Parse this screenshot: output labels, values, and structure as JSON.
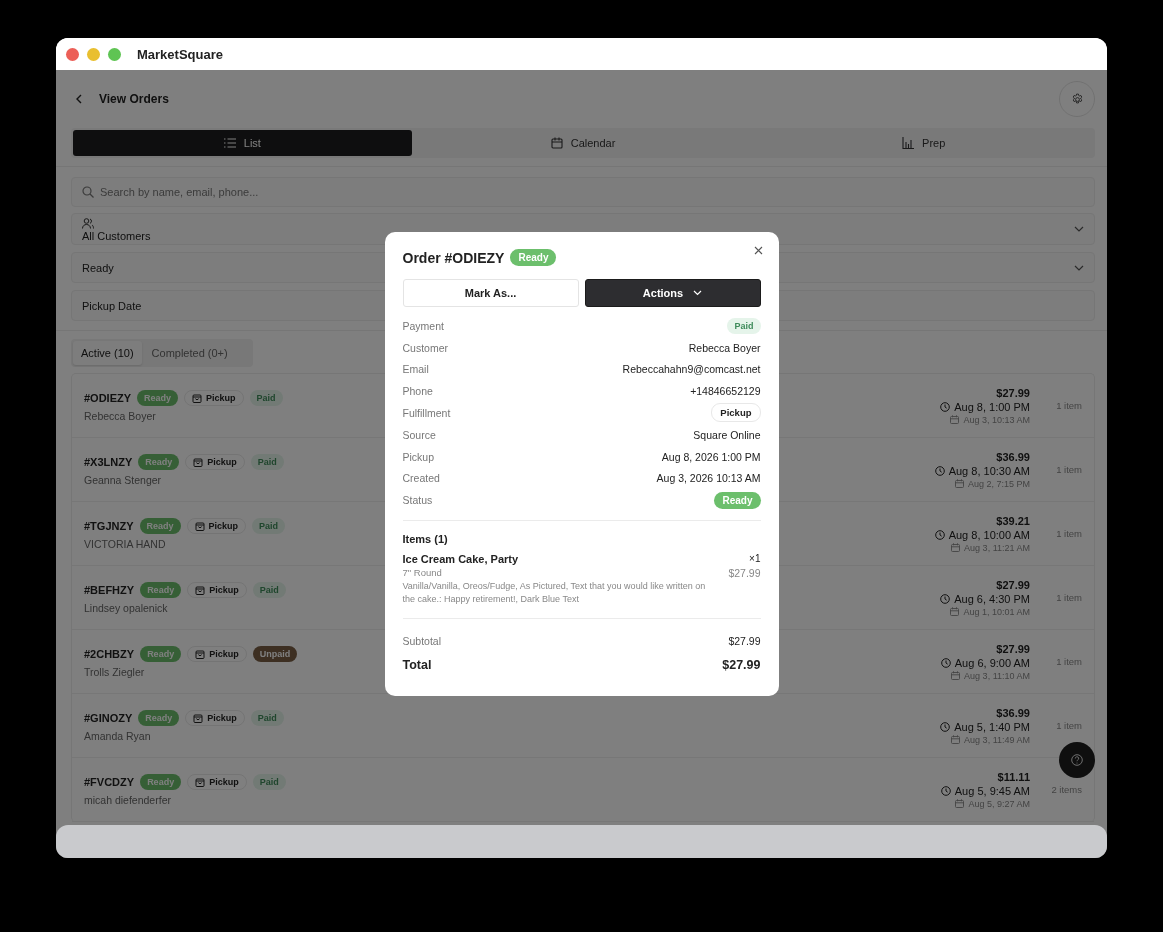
{
  "window": {
    "title": "MarketSquare"
  },
  "page": {
    "title": "View Orders"
  },
  "view_tabs": [
    {
      "label": "List",
      "selected": true
    },
    {
      "label": "Calendar",
      "selected": false
    },
    {
      "label": "Prep",
      "selected": false
    }
  ],
  "search": {
    "placeholder": "Search by name, email, phone..."
  },
  "filters": [
    {
      "label": "All Customers",
      "kind": "customers"
    },
    {
      "label": "Ready",
      "kind": "dropdown"
    },
    {
      "label": "Pickup Date",
      "kind": "date"
    }
  ],
  "status_tabs": [
    {
      "label": "Active (10)",
      "selected": true
    },
    {
      "label": "Completed (0+)",
      "selected": false
    }
  ],
  "orders": [
    {
      "id": "#ODIEZY",
      "status": "Ready",
      "fulfillment": "Pickup",
      "payment": {
        "label": "Paid",
        "kind": "paid"
      },
      "customer": "Rebecca Boyer",
      "total": "$27.99",
      "pickup": "Aug 8, 1:00 PM",
      "created": "Aug 3, 10:13 AM",
      "items": "1 item"
    },
    {
      "id": "#X3LNZY",
      "status": "Ready",
      "fulfillment": "Pickup",
      "payment": {
        "label": "Paid",
        "kind": "paid"
      },
      "customer": "Geanna Stenger",
      "total": "$36.99",
      "pickup": "Aug 8, 10:30 AM",
      "created": "Aug 2, 7:15 PM",
      "items": "1 item"
    },
    {
      "id": "#TGJNZY",
      "status": "Ready",
      "fulfillment": "Pickup",
      "payment": {
        "label": "Paid",
        "kind": "paid"
      },
      "customer": "VICTORIA HAND",
      "total": "$39.21",
      "pickup": "Aug 8, 10:00 AM",
      "created": "Aug 3, 11:21 AM",
      "items": "1 item"
    },
    {
      "id": "#BEFHZY",
      "status": "Ready",
      "fulfillment": "Pickup",
      "payment": {
        "label": "Paid",
        "kind": "paid"
      },
      "customer": "Lindsey opalenick",
      "total": "$27.99",
      "pickup": "Aug 6, 4:30 PM",
      "created": "Aug 1, 10:01 AM",
      "items": "1 item"
    },
    {
      "id": "#2CHBZY",
      "status": "Ready",
      "fulfillment": "Pickup",
      "payment": {
        "label": "Unpaid",
        "kind": "unpaid"
      },
      "customer": "Trolls Ziegler",
      "total": "$27.99",
      "pickup": "Aug 6, 9:00 AM",
      "created": "Aug 3, 11:10 AM",
      "items": "1 item"
    },
    {
      "id": "#GINOZY",
      "status": "Ready",
      "fulfillment": "Pickup",
      "payment": {
        "label": "Paid",
        "kind": "paid"
      },
      "customer": "Amanda Ryan",
      "total": "$36.99",
      "pickup": "Aug 5, 1:40 PM",
      "created": "Aug 3, 11:49 AM",
      "items": "1 item"
    },
    {
      "id": "#FVCDZY",
      "status": "Ready",
      "fulfillment": "Pickup",
      "payment": {
        "label": "Paid",
        "kind": "paid"
      },
      "customer": "micah diefenderfer",
      "total": "$11.11",
      "pickup": "Aug 5, 9:45 AM",
      "created": "Aug 5, 9:27 AM",
      "items": "2 items"
    }
  ],
  "modal": {
    "title": "Order #ODIEZY",
    "status": "Ready",
    "buttons": [
      {
        "label": "Mark As...",
        "kind": "outline"
      },
      {
        "label": "Actions",
        "kind": "dropdown"
      }
    ],
    "details": [
      {
        "label": "Payment",
        "value": "Paid",
        "kind": "paid"
      },
      {
        "label": "Customer",
        "value": "Rebecca Boyer",
        "kind": "text"
      },
      {
        "label": "Email",
        "value": "Rebeccahahn9@comcast.net",
        "kind": "text"
      },
      {
        "label": "Phone",
        "value": "+14846652129",
        "kind": "text"
      },
      {
        "label": "Fulfillment",
        "value": "Pickup",
        "kind": "pill"
      },
      {
        "label": "Source",
        "value": "Square Online",
        "kind": "text"
      },
      {
        "label": "Pickup",
        "value": "Aug 8, 2026 1:00 PM",
        "kind": "text"
      },
      {
        "label": "Created",
        "value": "Aug 3, 2026 10:13 AM",
        "kind": "text"
      },
      {
        "label": "Status",
        "value": "Ready",
        "kind": "ready"
      }
    ],
    "items_heading": "Items (1)",
    "items": [
      {
        "name": "Ice Cream Cake, Party",
        "variant": "7\" Round",
        "options": "Vanilla/Vanilla, Oreos/Fudge, As Pictured, Text that you would like written on the cake.: Happy retirement!, Dark Blue Text",
        "quantity": "×1",
        "price": "$27.99"
      }
    ],
    "subtotal": {
      "label": "Subtotal",
      "value": "$27.99"
    },
    "total": {
      "label": "Total",
      "value": "$27.99"
    }
  }
}
